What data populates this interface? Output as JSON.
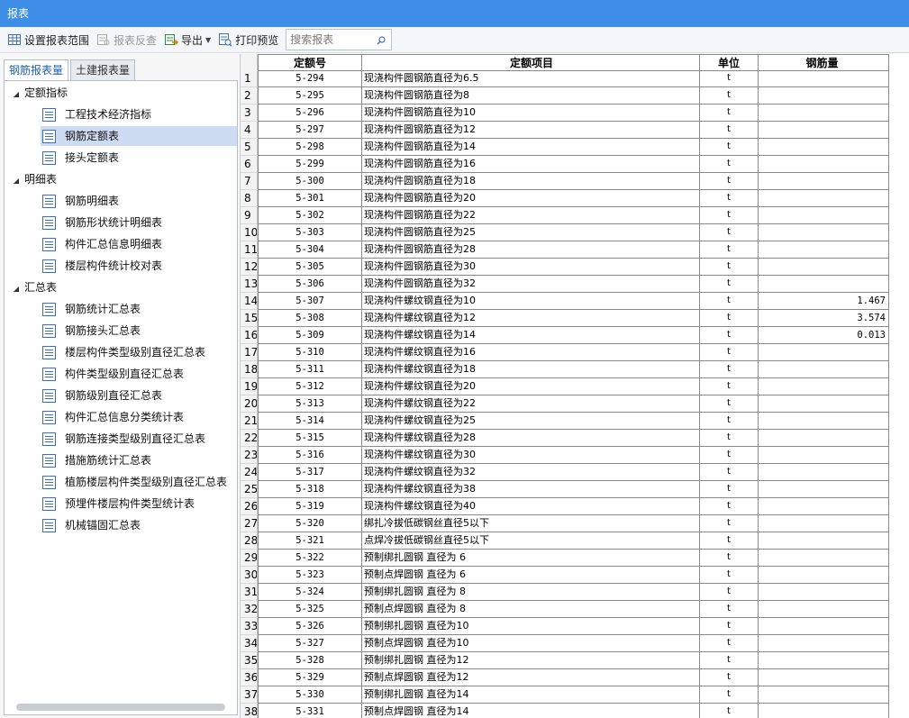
{
  "window": {
    "title": "报表"
  },
  "toolbar": {
    "set_range": "设置报表范围",
    "report_reverse": "报表反查",
    "export": "导出",
    "print_preview": "打印预览",
    "search_placeholder": "搜索报表"
  },
  "left_tabs": [
    "钢筋报表量",
    "土建报表量"
  ],
  "tree": {
    "groups": [
      {
        "label": "定额指标",
        "items": [
          "工程技术经济指标",
          "钢筋定额表",
          "接头定额表"
        ]
      },
      {
        "label": "明细表",
        "items": [
          "钢筋明细表",
          "钢筋形状统计明细表",
          "构件汇总信息明细表",
          "楼层构件统计校对表"
        ]
      },
      {
        "label": "汇总表",
        "items": [
          "钢筋统计汇总表",
          "钢筋接头汇总表",
          "楼层构件类型级别直径汇总表",
          "构件类型级别直径汇总表",
          "钢筋级别直径汇总表",
          "构件汇总信息分类统计表",
          "钢筋连接类型级别直径汇总表",
          "措施筋统计汇总表",
          "植筋楼层构件类型级别直径汇总表",
          "预埋件楼层构件类型统计表",
          "机械锚固汇总表"
        ]
      }
    ],
    "selected": "钢筋定额表"
  },
  "table": {
    "headers": {
      "code": "定额号",
      "name": "定额项目",
      "unit": "单位",
      "qty": "钢筋量"
    },
    "rows": [
      {
        "n": "1",
        "code": "5-294",
        "name": "现浇构件圆钢筋直径为6.5",
        "unit": "t",
        "qty": ""
      },
      {
        "n": "2",
        "code": "5-295",
        "name": "现浇构件圆钢筋直径为8",
        "unit": "t",
        "qty": ""
      },
      {
        "n": "3",
        "code": "5-296",
        "name": "现浇构件圆钢筋直径为10",
        "unit": "t",
        "qty": ""
      },
      {
        "n": "4",
        "code": "5-297",
        "name": "现浇构件圆钢筋直径为12",
        "unit": "t",
        "qty": ""
      },
      {
        "n": "5",
        "code": "5-298",
        "name": "现浇构件圆钢筋直径为14",
        "unit": "t",
        "qty": ""
      },
      {
        "n": "6",
        "code": "5-299",
        "name": "现浇构件圆钢筋直径为16",
        "unit": "t",
        "qty": ""
      },
      {
        "n": "7",
        "code": "5-300",
        "name": "现浇构件圆钢筋直径为18",
        "unit": "t",
        "qty": ""
      },
      {
        "n": "8",
        "code": "5-301",
        "name": "现浇构件圆钢筋直径为20",
        "unit": "t",
        "qty": ""
      },
      {
        "n": "9",
        "code": "5-302",
        "name": "现浇构件圆钢筋直径为22",
        "unit": "t",
        "qty": ""
      },
      {
        "n": "10",
        "code": "5-303",
        "name": "现浇构件圆钢筋直径为25",
        "unit": "t",
        "qty": ""
      },
      {
        "n": "11",
        "code": "5-304",
        "name": "现浇构件圆钢筋直径为28",
        "unit": "t",
        "qty": ""
      },
      {
        "n": "12",
        "code": "5-305",
        "name": "现浇构件圆钢筋直径为30",
        "unit": "t",
        "qty": ""
      },
      {
        "n": "13",
        "code": "5-306",
        "name": "现浇构件圆钢筋直径为32",
        "unit": "t",
        "qty": ""
      },
      {
        "n": "14",
        "code": "5-307",
        "name": "现浇构件螺纹钢直径为10",
        "unit": "t",
        "qty": "1.467"
      },
      {
        "n": "15",
        "code": "5-308",
        "name": "现浇构件螺纹钢直径为12",
        "unit": "t",
        "qty": "3.574"
      },
      {
        "n": "16",
        "code": "5-309",
        "name": "现浇构件螺纹钢直径为14",
        "unit": "t",
        "qty": "0.013"
      },
      {
        "n": "17",
        "code": "5-310",
        "name": "现浇构件螺纹钢直径为16",
        "unit": "t",
        "qty": ""
      },
      {
        "n": "18",
        "code": "5-311",
        "name": "现浇构件螺纹钢直径为18",
        "unit": "t",
        "qty": ""
      },
      {
        "n": "19",
        "code": "5-312",
        "name": "现浇构件螺纹钢直径为20",
        "unit": "t",
        "qty": ""
      },
      {
        "n": "20",
        "code": "5-313",
        "name": "现浇构件螺纹钢直径为22",
        "unit": "t",
        "qty": ""
      },
      {
        "n": "21",
        "code": "5-314",
        "name": "现浇构件螺纹钢直径为25",
        "unit": "t",
        "qty": ""
      },
      {
        "n": "22",
        "code": "5-315",
        "name": "现浇构件螺纹钢直径为28",
        "unit": "t",
        "qty": ""
      },
      {
        "n": "23",
        "code": "5-316",
        "name": "现浇构件螺纹钢直径为30",
        "unit": "t",
        "qty": ""
      },
      {
        "n": "24",
        "code": "5-317",
        "name": "现浇构件螺纹钢直径为32",
        "unit": "t",
        "qty": ""
      },
      {
        "n": "25",
        "code": "5-318",
        "name": "现浇构件螺纹钢直径为38",
        "unit": "t",
        "qty": ""
      },
      {
        "n": "26",
        "code": "5-319",
        "name": "现浇构件螺纹钢直径为40",
        "unit": "t",
        "qty": ""
      },
      {
        "n": "27",
        "code": "5-320",
        "name": "绑扎冷拔低碳钢丝直径5以下",
        "unit": "t",
        "qty": ""
      },
      {
        "n": "28",
        "code": "5-321",
        "name": "点焊冷拔低碳钢丝直径5以下",
        "unit": "t",
        "qty": ""
      },
      {
        "n": "29",
        "code": "5-322",
        "name": "预制绑扎圆钢 直径为 6",
        "unit": "t",
        "qty": ""
      },
      {
        "n": "30",
        "code": "5-323",
        "name": "预制点焊圆钢 直径为 6",
        "unit": "t",
        "qty": ""
      },
      {
        "n": "31",
        "code": "5-324",
        "name": "预制绑扎圆钢 直径为 8",
        "unit": "t",
        "qty": ""
      },
      {
        "n": "32",
        "code": "5-325",
        "name": "预制点焊圆钢 直径为 8",
        "unit": "t",
        "qty": ""
      },
      {
        "n": "33",
        "code": "5-326",
        "name": "预制绑扎圆钢 直径为10",
        "unit": "t",
        "qty": ""
      },
      {
        "n": "34",
        "code": "5-327",
        "name": "预制点焊圆钢 直径为10",
        "unit": "t",
        "qty": ""
      },
      {
        "n": "35",
        "code": "5-328",
        "name": "预制绑扎圆钢 直径为12",
        "unit": "t",
        "qty": ""
      },
      {
        "n": "36",
        "code": "5-329",
        "name": "预制点焊圆钢 直径为12",
        "unit": "t",
        "qty": ""
      },
      {
        "n": "37",
        "code": "5-330",
        "name": "预制绑扎圆钢 直径为14",
        "unit": "t",
        "qty": ""
      },
      {
        "n": "38",
        "code": "5-331",
        "name": "预制点焊圆钢 直径为14",
        "unit": "t",
        "qty": ""
      }
    ]
  },
  "icons": {
    "set_range": "grid-settings-icon",
    "report_reverse": "report-lookup-icon",
    "export": "export-icon",
    "print_preview": "print-preview-icon",
    "search": "search-icon",
    "tree_item": "report-document-icon"
  },
  "colors": {
    "titlebar": "#3c8ee6",
    "selected": "#cddcf2",
    "tab_active_text": "#1f5fb8"
  }
}
